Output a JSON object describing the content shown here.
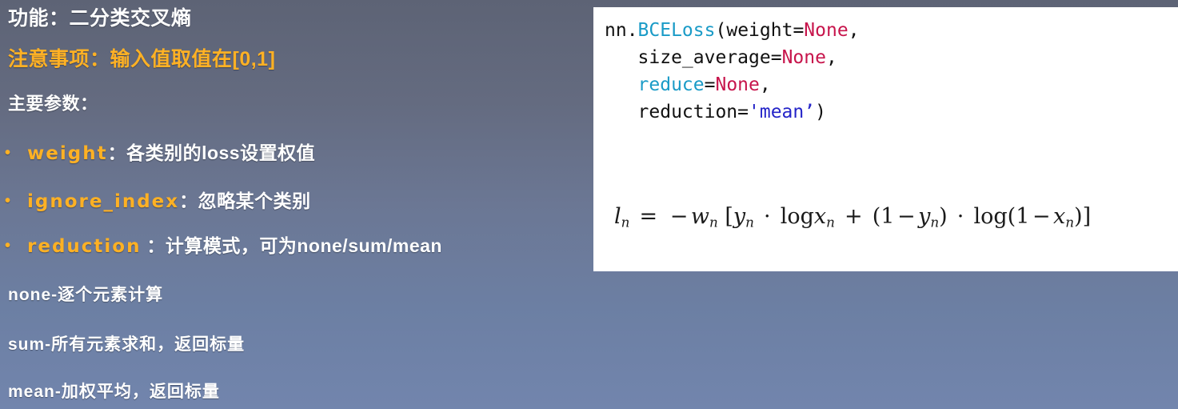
{
  "theme": {
    "bg_top": "#5d6375",
    "bg_bottom": "#7285ad",
    "accent_orange": "#ffb124",
    "text_white": "#ffffff",
    "card_bg": "#ffffff",
    "code_fn": "#1a9bc7",
    "code_keyword": "#c7154c",
    "code_string": "#2424c8"
  },
  "left": {
    "title": "功能：二分类交叉熵",
    "note": "注意事项：输入值取值在[0,1]",
    "params_heading": "主要参数：",
    "bullet_marker": "•",
    "bullets": [
      {
        "name": "weight",
        "sep": "：",
        "desc": "各类别的loss设置权值"
      },
      {
        "name": "ignore_index",
        "sep": "：",
        "desc": "忽略某个类别"
      },
      {
        "name": "reduction",
        "sep": " ：",
        "desc": "计算模式，可为none/sum/mean"
      }
    ],
    "modes": [
      "none-逐个元素计算",
      "sum-所有元素求和，返回标量",
      "mean-加权平均，返回标量"
    ]
  },
  "card": {
    "code": {
      "line1": {
        "prefix": "nn.",
        "fn": "BCELoss",
        "open": "(",
        "arg": "weight",
        "eq": "=",
        "kw": "None",
        "comma": ","
      },
      "line2": {
        "arg": "size_average",
        "eq": "=",
        "kw": "None",
        "comma": ","
      },
      "line3": {
        "arg": "reduce",
        "eq": "=",
        "kw": "None",
        "comma": ","
      },
      "line4": {
        "arg": "reduction",
        "eq": "=",
        "str": "'mean’",
        "close": ")"
      }
    },
    "formula": {
      "plain": "l_n = -w_n [ y_n · log x_n + (1 - y_n) · log(1 - x_n) ]",
      "lhs_var": "l",
      "lhs_sub": "n",
      "equals": "=",
      "minus": "−",
      "w_var": "w",
      "w_sub": "n",
      "open_bracket": "[",
      "y_var": "y",
      "y_sub": "n",
      "cdot": "·",
      "log": "log",
      "x_var": "x",
      "x_sub": "n",
      "plus": "+",
      "one": "1",
      "close_bracket": "]"
    }
  }
}
